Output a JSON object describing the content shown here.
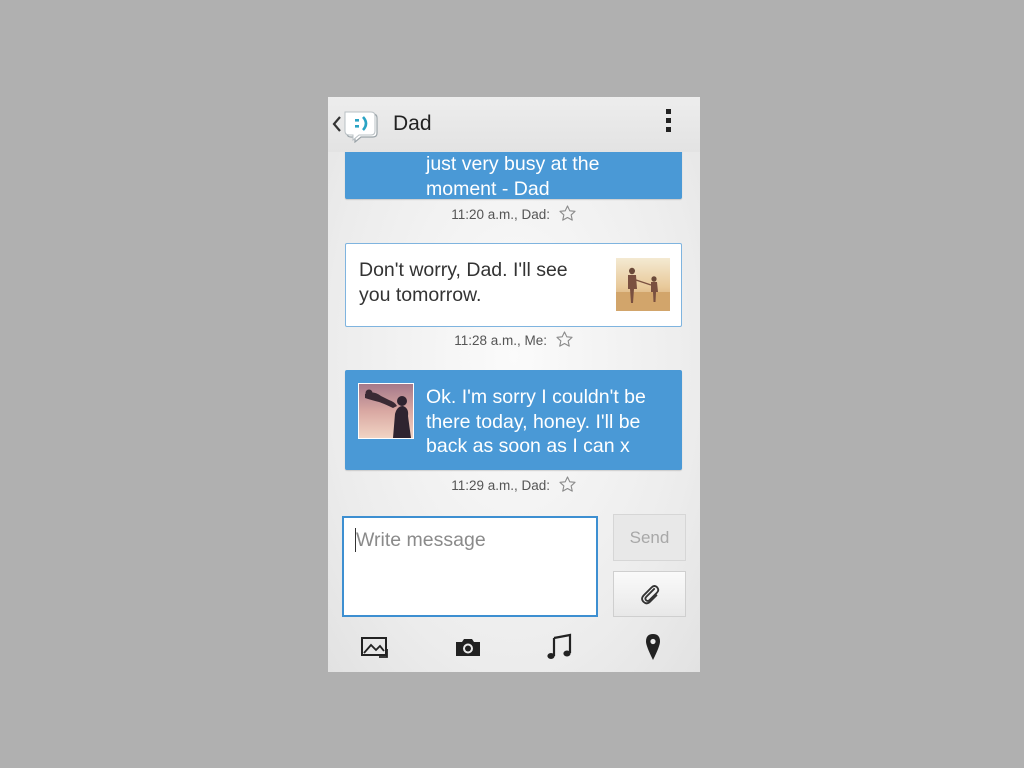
{
  "header": {
    "title": "Dad",
    "icons": {
      "back": "chevron-left-icon",
      "app": "messaging-app-icon",
      "menu": "more-vertical-icon"
    }
  },
  "messages": [
    {
      "from": "Dad",
      "text_lines": [
        "just very busy at the",
        "moment - Dad"
      ],
      "meta": "11:20 a.m., Dad:",
      "starred": false
    },
    {
      "from": "Me",
      "text_lines": [
        "Don't worry, Dad. I'll see",
        "you tomorrow."
      ],
      "meta": "11:28 a.m., Me:",
      "starred": false
    },
    {
      "from": "Dad",
      "text_lines": [
        "Ok. I'm sorry I couldn't be",
        "there today, honey. I'll be",
        "back as soon as I can x"
      ],
      "meta": "11:29 a.m., Dad:",
      "starred": false
    }
  ],
  "composer": {
    "placeholder": "Write message",
    "send_label": "Send",
    "attach_icon": "paperclip-icon"
  },
  "attachment_bar": [
    "gallery-icon",
    "camera-icon",
    "music-icon",
    "location-pin-icon"
  ],
  "colors": {
    "incoming_bubble": "#4a99d6",
    "outgoing_border": "#7fb4df",
    "accent": "#3d8fd1"
  }
}
